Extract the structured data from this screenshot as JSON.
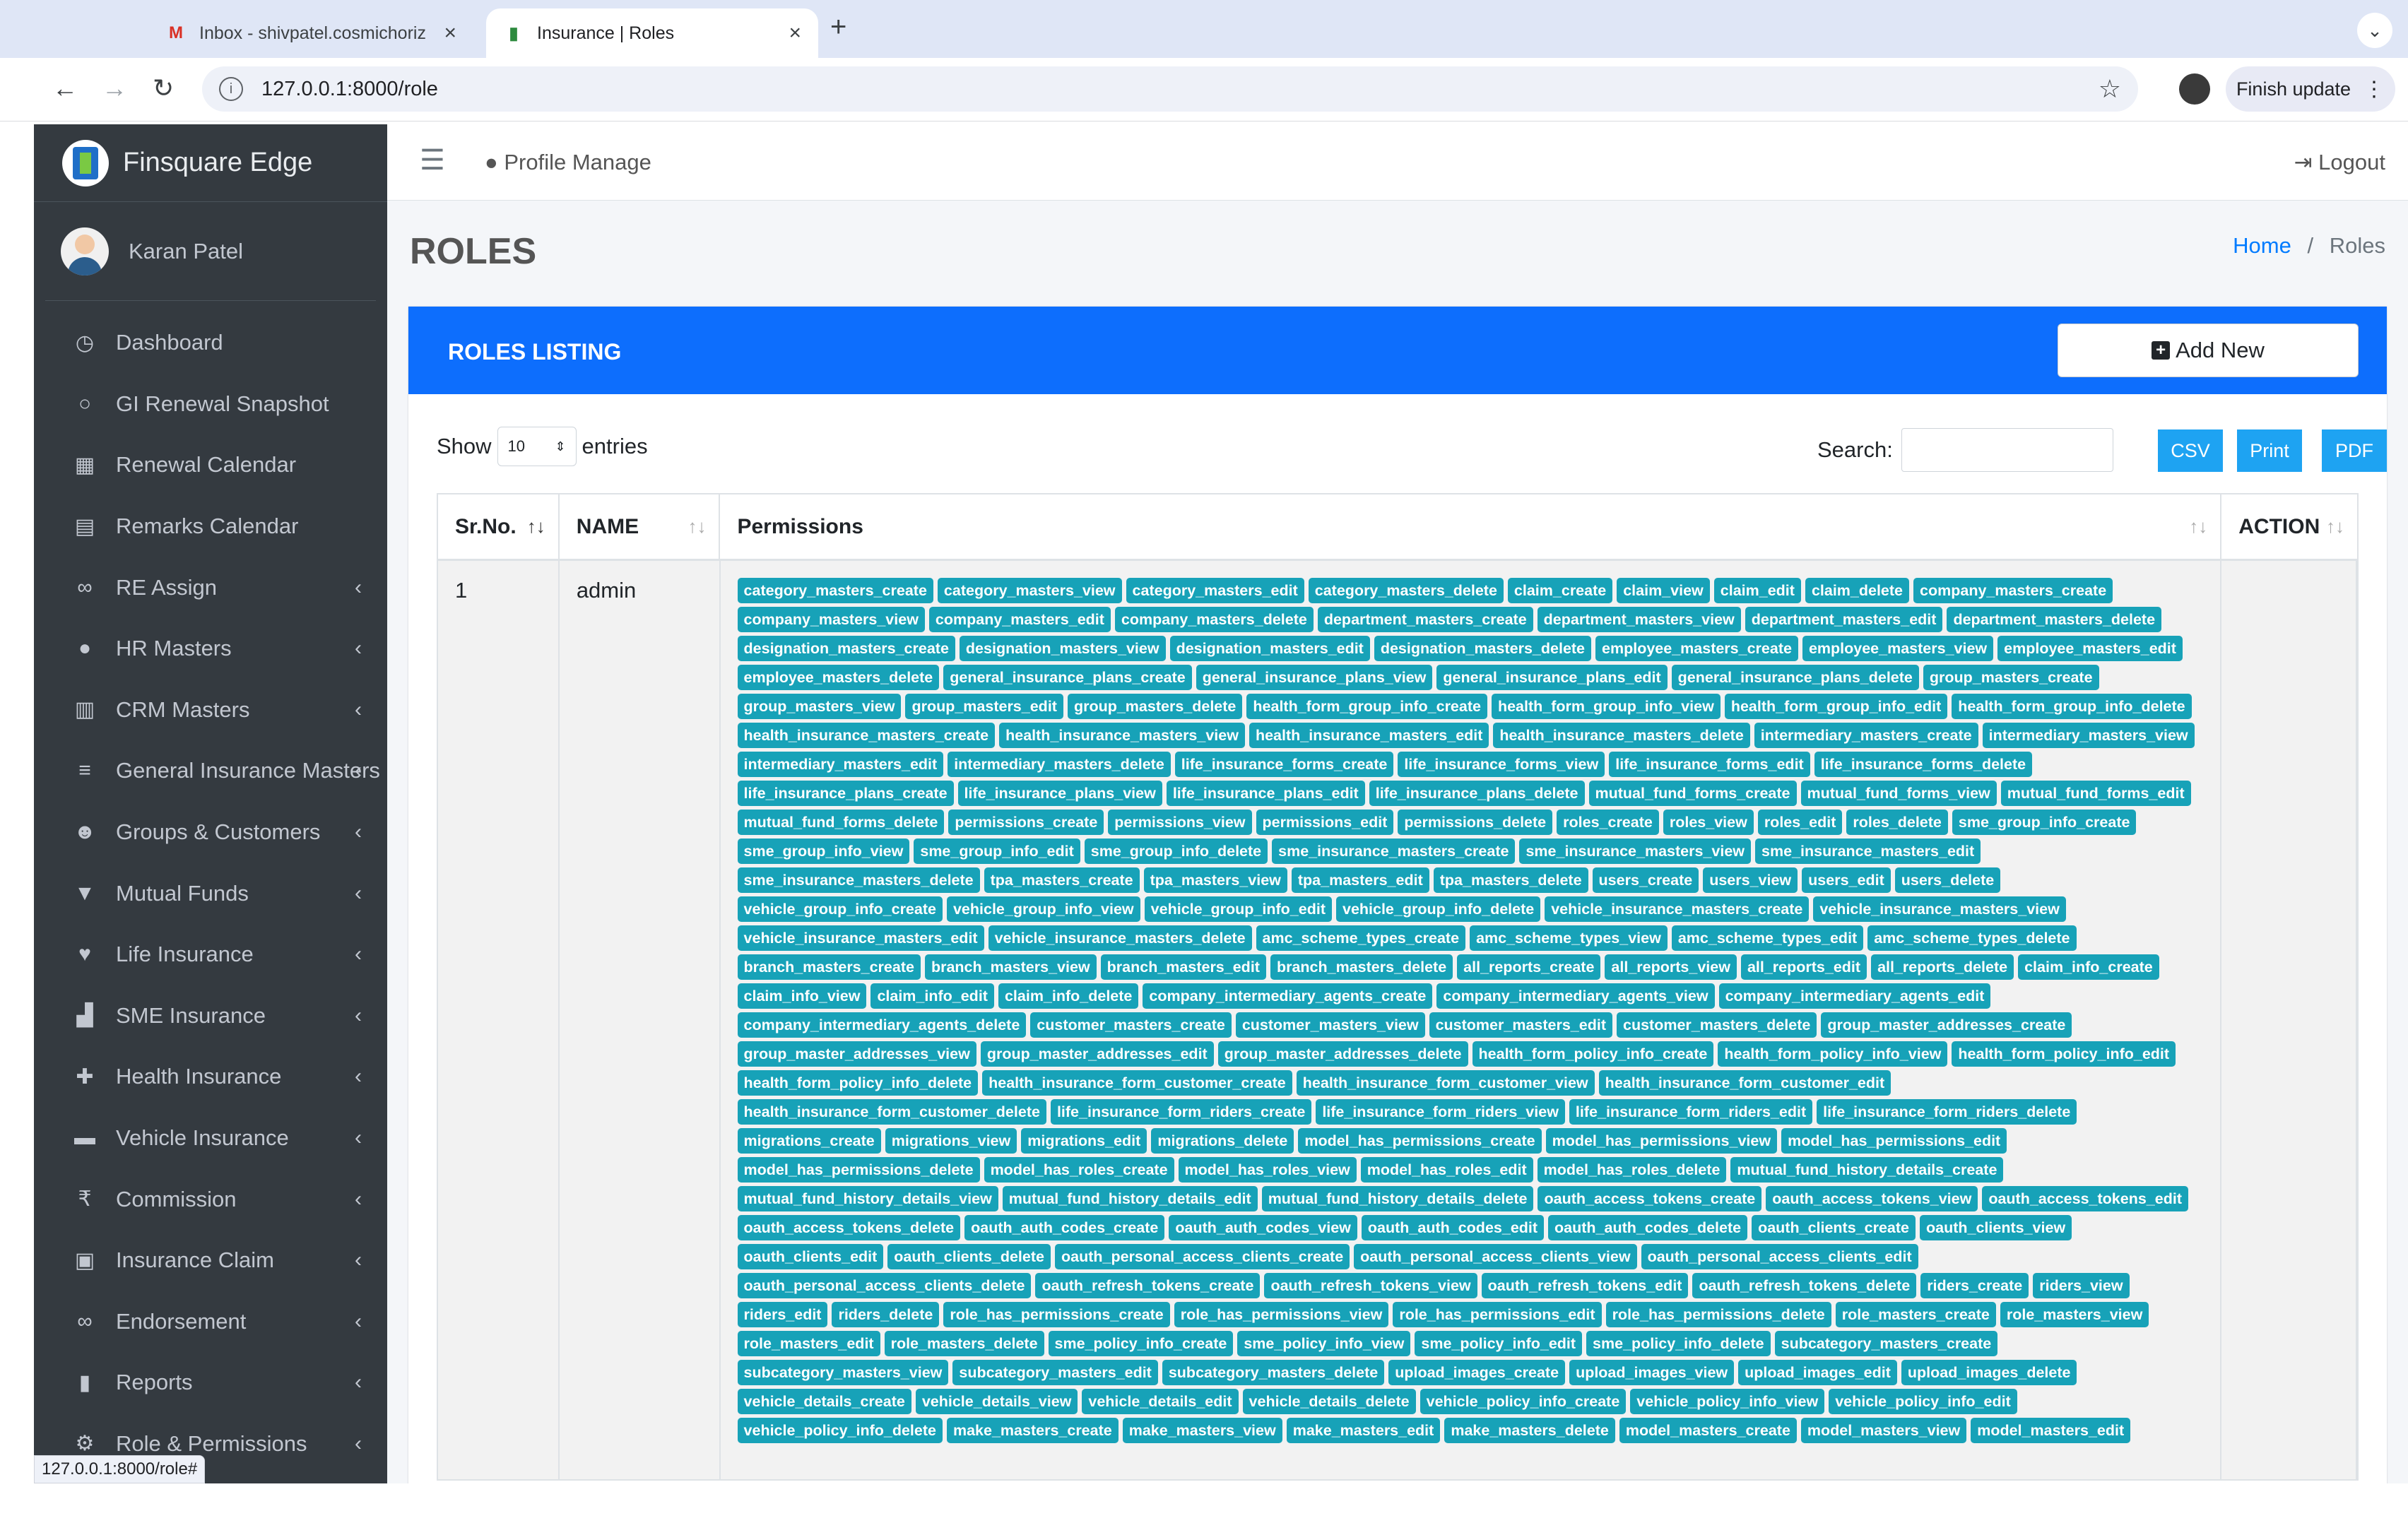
{
  "browser": {
    "tabs": [
      {
        "title": "Inbox - shivpatel.cosmichoriz",
        "icon": "gmail-icon"
      },
      {
        "title": "Insurance | Roles",
        "icon": "site-favicon"
      }
    ],
    "url": "127.0.0.1:8000/role",
    "finish_update": "Finish update",
    "status_url": "127.0.0.1:8000/role#"
  },
  "brand": "Finsquare Edge",
  "user": "Karan Patel",
  "sidebar": {
    "items": [
      {
        "label": "Dashboard",
        "icon": "dashboard-icon",
        "glyph": "◷",
        "chevron": false
      },
      {
        "label": "GI Renewal Snapshot",
        "icon": "circle-icon",
        "glyph": "○",
        "chevron": false
      },
      {
        "label": "Renewal Calendar",
        "icon": "calendar-icon",
        "glyph": "▦",
        "chevron": false
      },
      {
        "label": "Remarks Calendar",
        "icon": "calendar-icon",
        "glyph": "▤",
        "chevron": false
      },
      {
        "label": "RE Assign",
        "icon": "link-icon",
        "glyph": "∞",
        "chevron": true
      },
      {
        "label": "HR Masters",
        "icon": "user-icon",
        "glyph": "●",
        "chevron": true
      },
      {
        "label": "CRM Masters",
        "icon": "building-icon",
        "glyph": "▥",
        "chevron": true
      },
      {
        "label": "General Insurance Masters",
        "icon": "database-icon",
        "glyph": "≡",
        "chevron": true
      },
      {
        "label": "Groups & Customers",
        "icon": "users-icon",
        "glyph": "☻",
        "chevron": true
      },
      {
        "label": "Mutual Funds",
        "icon": "filter-icon",
        "glyph": "▼",
        "chevron": true
      },
      {
        "label": "Life Insurance",
        "icon": "heart-icon",
        "glyph": "♥",
        "chevron": true
      },
      {
        "label": "SME Insurance",
        "icon": "chart-icon",
        "glyph": "▟",
        "chevron": true
      },
      {
        "label": "Health Insurance",
        "icon": "plus-square-icon",
        "glyph": "✚",
        "chevron": true
      },
      {
        "label": "Vehicle Insurance",
        "icon": "car-icon",
        "glyph": "▬",
        "chevron": true
      },
      {
        "label": "Commission",
        "icon": "rupee-icon",
        "glyph": "₹",
        "chevron": true
      },
      {
        "label": "Insurance Claim",
        "icon": "truck-icon",
        "glyph": "▣",
        "chevron": true
      },
      {
        "label": "Endorsement",
        "icon": "link-icon",
        "glyph": "∞",
        "chevron": true
      },
      {
        "label": "Reports",
        "icon": "file-icon",
        "glyph": "▮",
        "chevron": true
      },
      {
        "label": "Role & Permissions",
        "icon": "cogs-icon",
        "glyph": "⚙",
        "chevron": true
      }
    ]
  },
  "topbar": {
    "profile": "Profile Manage",
    "logout": "Logout"
  },
  "page": {
    "title": "ROLES",
    "breadcrumb_home": "Home",
    "breadcrumb_sep": "/",
    "breadcrumb_current": "Roles"
  },
  "card": {
    "title": "ROLES LISTING",
    "add_new": "Add New"
  },
  "controls": {
    "show": "Show",
    "entries_value": "10",
    "entries": "entries",
    "search": "Search:",
    "csv": "CSV",
    "print": "Print",
    "pdf": "PDF"
  },
  "table": {
    "headers": [
      "Sr.No.",
      "NAME",
      "Permissions",
      "ACTION"
    ],
    "rows": [
      {
        "srno": "1",
        "name": "admin",
        "permissions": [
          "category_masters_create",
          "category_masters_view",
          "category_masters_edit",
          "category_masters_delete",
          "claim_create",
          "claim_view",
          "claim_edit",
          "claim_delete",
          "company_masters_create",
          "company_masters_view",
          "company_masters_edit",
          "company_masters_delete",
          "department_masters_create",
          "department_masters_view",
          "department_masters_edit",
          "department_masters_delete",
          "designation_masters_create",
          "designation_masters_view",
          "designation_masters_edit",
          "designation_masters_delete",
          "employee_masters_create",
          "employee_masters_view",
          "employee_masters_edit",
          "employee_masters_delete",
          "general_insurance_plans_create",
          "general_insurance_plans_view",
          "general_insurance_plans_edit",
          "general_insurance_plans_delete",
          "group_masters_create",
          "group_masters_view",
          "group_masters_edit",
          "group_masters_delete",
          "health_form_group_info_create",
          "health_form_group_info_view",
          "health_form_group_info_edit",
          "health_form_group_info_delete",
          "health_insurance_masters_create",
          "health_insurance_masters_view",
          "health_insurance_masters_edit",
          "health_insurance_masters_delete",
          "intermediary_masters_create",
          "intermediary_masters_view",
          "intermediary_masters_edit",
          "intermediary_masters_delete",
          "life_insurance_forms_create",
          "life_insurance_forms_view",
          "life_insurance_forms_edit",
          "life_insurance_forms_delete",
          "life_insurance_plans_create",
          "life_insurance_plans_view",
          "life_insurance_plans_edit",
          "life_insurance_plans_delete",
          "mutual_fund_forms_create",
          "mutual_fund_forms_view",
          "mutual_fund_forms_edit",
          "mutual_fund_forms_delete",
          "permissions_create",
          "permissions_view",
          "permissions_edit",
          "permissions_delete",
          "roles_create",
          "roles_view",
          "roles_edit",
          "roles_delete",
          "sme_group_info_create",
          "sme_group_info_view",
          "sme_group_info_edit",
          "sme_group_info_delete",
          "sme_insurance_masters_create",
          "sme_insurance_masters_view",
          "sme_insurance_masters_edit",
          "sme_insurance_masters_delete",
          "tpa_masters_create",
          "tpa_masters_view",
          "tpa_masters_edit",
          "tpa_masters_delete",
          "users_create",
          "users_view",
          "users_edit",
          "users_delete",
          "vehicle_group_info_create",
          "vehicle_group_info_view",
          "vehicle_group_info_edit",
          "vehicle_group_info_delete",
          "vehicle_insurance_masters_create",
          "vehicle_insurance_masters_view",
          "vehicle_insurance_masters_edit",
          "vehicle_insurance_masters_delete",
          "amc_scheme_types_create",
          "amc_scheme_types_view",
          "amc_scheme_types_edit",
          "amc_scheme_types_delete",
          "branch_masters_create",
          "branch_masters_view",
          "branch_masters_edit",
          "branch_masters_delete",
          "all_reports_create",
          "all_reports_view",
          "all_reports_edit",
          "all_reports_delete",
          "claim_info_create",
          "claim_info_view",
          "claim_info_edit",
          "claim_info_delete",
          "company_intermediary_agents_create",
          "company_intermediary_agents_view",
          "company_intermediary_agents_edit",
          "company_intermediary_agents_delete",
          "customer_masters_create",
          "customer_masters_view",
          "customer_masters_edit",
          "customer_masters_delete",
          "group_master_addresses_create",
          "group_master_addresses_view",
          "group_master_addresses_edit",
          "group_master_addresses_delete",
          "health_form_policy_info_create",
          "health_form_policy_info_view",
          "health_form_policy_info_edit",
          "health_form_policy_info_delete",
          "health_insurance_form_customer_create",
          "health_insurance_form_customer_view",
          "health_insurance_form_customer_edit",
          "health_insurance_form_customer_delete",
          "life_insurance_form_riders_create",
          "life_insurance_form_riders_view",
          "life_insurance_form_riders_edit",
          "life_insurance_form_riders_delete",
          "migrations_create",
          "migrations_view",
          "migrations_edit",
          "migrations_delete",
          "model_has_permissions_create",
          "model_has_permissions_view",
          "model_has_permissions_edit",
          "model_has_permissions_delete",
          "model_has_roles_create",
          "model_has_roles_view",
          "model_has_roles_edit",
          "model_has_roles_delete",
          "mutual_fund_history_details_create",
          "mutual_fund_history_details_view",
          "mutual_fund_history_details_edit",
          "mutual_fund_history_details_delete",
          "oauth_access_tokens_create",
          "oauth_access_tokens_view",
          "oauth_access_tokens_edit",
          "oauth_access_tokens_delete",
          "oauth_auth_codes_create",
          "oauth_auth_codes_view",
          "oauth_auth_codes_edit",
          "oauth_auth_codes_delete",
          "oauth_clients_create",
          "oauth_clients_view",
          "oauth_clients_edit",
          "oauth_clients_delete",
          "oauth_personal_access_clients_create",
          "oauth_personal_access_clients_view",
          "oauth_personal_access_clients_edit",
          "oauth_personal_access_clients_delete",
          "oauth_refresh_tokens_create",
          "oauth_refresh_tokens_view",
          "oauth_refresh_tokens_edit",
          "oauth_refresh_tokens_delete",
          "riders_create",
          "riders_view",
          "riders_edit",
          "riders_delete",
          "role_has_permissions_create",
          "role_has_permissions_view",
          "role_has_permissions_edit",
          "role_has_permissions_delete",
          "role_masters_create",
          "role_masters_view",
          "role_masters_edit",
          "role_masters_delete",
          "sme_policy_info_create",
          "sme_policy_info_view",
          "sme_policy_info_edit",
          "sme_policy_info_delete",
          "subcategory_masters_create",
          "subcategory_masters_view",
          "subcategory_masters_edit",
          "subcategory_masters_delete",
          "upload_images_create",
          "upload_images_view",
          "upload_images_edit",
          "upload_images_delete",
          "vehicle_details_create",
          "vehicle_details_view",
          "vehicle_details_edit",
          "vehicle_details_delete",
          "vehicle_policy_info_create",
          "vehicle_policy_info_view",
          "vehicle_policy_info_edit",
          "vehicle_policy_info_delete",
          "make_masters_create",
          "make_masters_view",
          "make_masters_edit",
          "make_masters_delete",
          "model_masters_create",
          "model_masters_view",
          "model_masters_edit"
        ]
      }
    ]
  },
  "colors": {
    "primary": "#0d6efd",
    "badge": "#17a2b8",
    "sidebar": "#343a40",
    "export_button": "#1ea3f2"
  }
}
